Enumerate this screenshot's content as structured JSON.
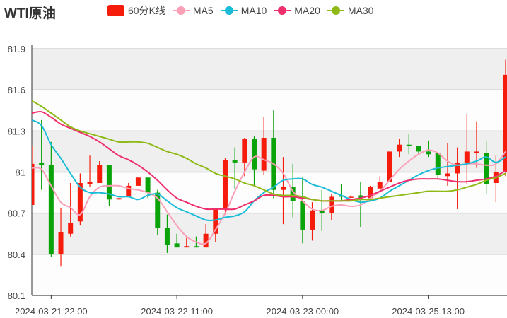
{
  "title": "WTI原油",
  "legend": [
    {
      "label": "60分K线",
      "color": "#f51c0c",
      "type": "kline"
    },
    {
      "label": "MA5",
      "color": "#fca0b8",
      "type": "line"
    },
    {
      "label": "MA10",
      "color": "#1bbcd8",
      "type": "line"
    },
    {
      "label": "MA20",
      "color": "#ee2f6c",
      "type": "line"
    },
    {
      "label": "MA30",
      "color": "#8fba16",
      "type": "line"
    }
  ],
  "chart_data": {
    "type": "candlestick",
    "title": "WTI原油",
    "ylim": [
      80.1,
      81.9
    ],
    "y_ticks": [
      "80.1",
      "80.4",
      "80.7",
      "81",
      "81.3",
      "81.6",
      "81.9"
    ],
    "x_ticks": [
      {
        "index": 2,
        "label": "2024-03-21 22:00"
      },
      {
        "index": 15,
        "label": "2024-03-22 11:00"
      },
      {
        "index": 28,
        "label": "2024-03-23 00:00"
      },
      {
        "index": 41,
        "label": "2024-03-25 13:00"
      }
    ],
    "up_color": "#f51c0c",
    "down_color": "#0aa30a",
    "grid": true,
    "candles_ohlc": [
      [
        80.76,
        81.19,
        80.76,
        81.06
      ],
      [
        81.07,
        81.38,
        80.87,
        81.05
      ],
      [
        81.05,
        81.22,
        80.38,
        80.4
      ],
      [
        80.4,
        80.74,
        80.31,
        80.56
      ],
      [
        80.55,
        80.92,
        80.53,
        80.63
      ],
      [
        80.64,
        80.99,
        80.61,
        80.92
      ],
      [
        80.91,
        81.12,
        80.89,
        80.93
      ],
      [
        80.92,
        81.08,
        80.92,
        81.05
      ],
      [
        81.05,
        81.05,
        80.75,
        80.8
      ],
      [
        80.8,
        80.81,
        80.8,
        80.81
      ],
      [
        80.82,
        80.92,
        80.82,
        80.9
      ],
      [
        80.9,
        80.96,
        80.9,
        80.96
      ],
      [
        80.96,
        80.96,
        80.81,
        80.85
      ],
      [
        80.85,
        80.87,
        80.54,
        80.59
      ],
      [
        80.59,
        80.69,
        80.41,
        80.47
      ],
      [
        80.48,
        80.55,
        80.45,
        80.45
      ],
      [
        80.45,
        80.52,
        80.45,
        80.46
      ],
      [
        80.46,
        80.53,
        80.45,
        80.45
      ],
      [
        80.45,
        80.62,
        80.45,
        80.55
      ],
      [
        80.55,
        80.74,
        80.49,
        80.73
      ],
      [
        80.73,
        81.1,
        80.69,
        81.09
      ],
      [
        81.09,
        81.18,
        80.88,
        81.07
      ],
      [
        81.07,
        81.25,
        80.97,
        81.24
      ],
      [
        81.24,
        81.26,
        80.9,
        81.02
      ],
      [
        81.01,
        81.4,
        80.98,
        81.25
      ],
      [
        81.25,
        81.45,
        80.81,
        80.87
      ],
      [
        80.87,
        81.11,
        80.62,
        80.89
      ],
      [
        80.89,
        81.06,
        80.67,
        80.79
      ],
      [
        80.79,
        80.96,
        80.48,
        80.58
      ],
      [
        80.58,
        80.78,
        80.5,
        80.72
      ],
      [
        80.72,
        80.87,
        80.57,
        80.7
      ],
      [
        80.7,
        80.84,
        80.65,
        80.82
      ],
      [
        80.83,
        80.91,
        80.79,
        80.82
      ],
      [
        80.82,
        80.83,
        80.81,
        80.82
      ],
      [
        80.83,
        80.93,
        80.6,
        80.81
      ],
      [
        80.81,
        80.9,
        80.79,
        80.89
      ],
      [
        80.88,
        80.97,
        80.88,
        80.93
      ],
      [
        80.93,
        81.15,
        80.93,
        81.15
      ],
      [
        81.15,
        81.24,
        81.11,
        81.2
      ],
      [
        81.2,
        81.28,
        81.13,
        81.19
      ],
      [
        81.19,
        81.19,
        81.13,
        81.15
      ],
      [
        81.15,
        81.23,
        81.11,
        81.13
      ],
      [
        81.14,
        81.14,
        80.95,
        80.98
      ],
      [
        80.97,
        81.21,
        80.9,
        80.99
      ],
      [
        80.99,
        81.18,
        80.73,
        81.07
      ],
      [
        81.07,
        81.42,
        80.91,
        81.15
      ],
      [
        81.14,
        81.37,
        81.03,
        81.15
      ],
      [
        81.14,
        81.23,
        80.84,
        80.91
      ],
      [
        80.92,
        81.12,
        80.78,
        81.0
      ],
      [
        81.0,
        81.82,
        80.97,
        81.71
      ]
    ],
    "series": [
      {
        "name": "MA5",
        "values": [
          81.03,
          81.02,
          80.9,
          80.78,
          80.74,
          80.69,
          80.82,
          80.89,
          80.9,
          80.9,
          80.88,
          80.87,
          80.85,
          80.81,
          80.71,
          80.61,
          80.53,
          80.49,
          80.48,
          80.58,
          80.7,
          80.86,
          81.0,
          81.11,
          81.09,
          81.06,
          80.99,
          80.86,
          80.79,
          80.73,
          80.72,
          80.75,
          80.76,
          80.75,
          80.76,
          80.81,
          80.86,
          80.94,
          81.02,
          81.08,
          81.13,
          81.16,
          81.14,
          81.08,
          81.05,
          81.06,
          81.06,
          81.05,
          81.06,
          81.15
        ]
      },
      {
        "name": "MA10",
        "values": [
          81.38,
          81.34,
          81.2,
          81.1,
          80.99,
          80.89,
          80.85,
          80.85,
          80.84,
          80.82,
          80.82,
          80.8,
          80.83,
          80.84,
          80.79,
          80.74,
          80.71,
          80.68,
          80.65,
          80.65,
          80.67,
          80.68,
          80.71,
          80.79,
          80.85,
          80.89,
          80.94,
          80.95,
          80.95,
          80.91,
          80.89,
          80.86,
          80.83,
          80.8,
          80.78,
          80.79,
          80.81,
          80.86,
          80.9,
          80.94,
          80.98,
          81.01,
          81.03,
          81.04,
          81.05,
          81.06,
          81.08,
          81.11,
          81.07,
          81.11
        ]
      },
      {
        "name": "MA20",
        "values": [
          81.43,
          81.44,
          81.4,
          81.35,
          81.32,
          81.29,
          81.26,
          81.22,
          81.17,
          81.12,
          81.09,
          81.05,
          81.0,
          80.94,
          80.87,
          80.81,
          80.78,
          80.75,
          80.73,
          80.73,
          80.73,
          80.73,
          80.76,
          80.79,
          80.83,
          80.83,
          80.82,
          80.82,
          80.81,
          80.8,
          80.79,
          80.79,
          80.79,
          80.8,
          80.81,
          80.83,
          80.86,
          80.89,
          80.92,
          80.94,
          80.95,
          80.95,
          80.95,
          80.94,
          80.93,
          80.93,
          80.94,
          80.95,
          80.97,
          81.01
        ]
      },
      {
        "name": "MA30",
        "values": [
          81.52,
          81.48,
          81.43,
          81.38,
          81.33,
          81.3,
          81.28,
          81.26,
          81.24,
          81.22,
          81.22,
          81.22,
          81.21,
          81.18,
          81.15,
          81.13,
          81.1,
          81.06,
          81.03,
          80.99,
          80.97,
          80.95,
          80.92,
          80.9,
          80.87,
          80.84,
          80.83,
          80.83,
          80.82,
          80.8,
          80.79,
          80.79,
          80.79,
          80.79,
          80.8,
          80.8,
          80.81,
          80.82,
          80.83,
          80.84,
          80.85,
          80.86,
          80.86,
          80.86,
          80.87,
          80.89,
          80.91,
          80.94,
          80.96,
          80.99
        ]
      }
    ]
  }
}
